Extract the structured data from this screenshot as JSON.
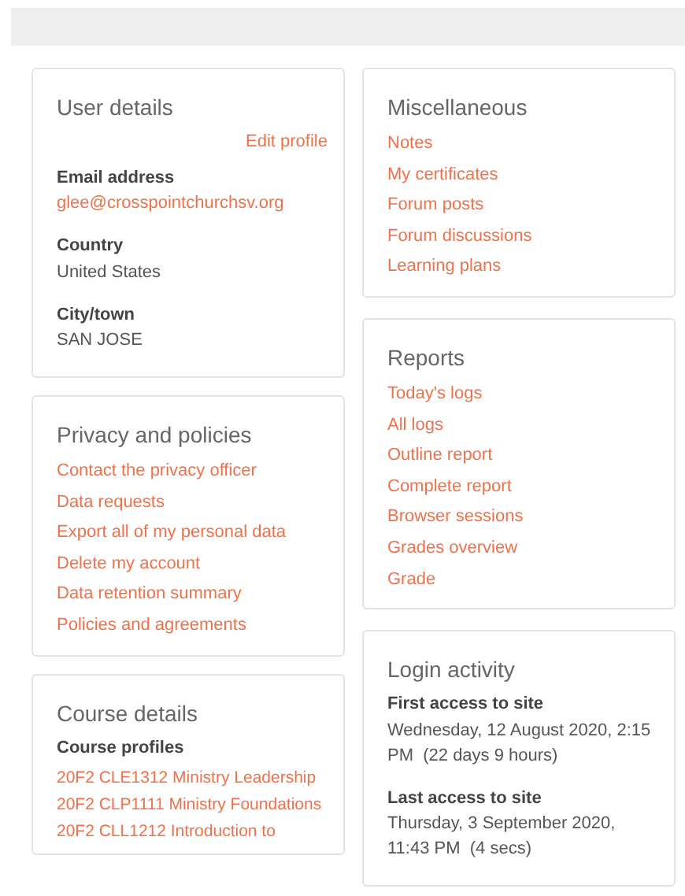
{
  "left_column": [
    {
      "kind": "details",
      "title": "User details",
      "action": "Edit profile",
      "fields": [
        {
          "label": "Email address",
          "value": "glee@crosspointchurchsv.org",
          "link": true
        },
        {
          "label": "Country",
          "value": "United States",
          "link": false
        },
        {
          "label": "City/town",
          "value": "SAN JOSE",
          "link": false
        }
      ]
    },
    {
      "kind": "links",
      "title": "Privacy and policies",
      "links": [
        "Contact the privacy officer",
        "Data requests",
        "Export all of my personal data",
        "Delete my account",
        "Data retention summary",
        "Policies and agreements"
      ]
    },
    {
      "kind": "courses",
      "title": "Course details",
      "subtitle": "Course profiles",
      "links": [
        "20F2 CLE1312 Ministry Leadership",
        "20F2 CLP1111 Ministry Foundations",
        "20F2 CLL1212 Introduction to"
      ]
    }
  ],
  "right_column": [
    {
      "kind": "links",
      "title": "Miscellaneous",
      "links": [
        "Notes",
        "My certificates",
        "Forum posts",
        "Forum discussions",
        "Learning plans"
      ]
    },
    {
      "kind": "links",
      "title": "Reports",
      "links": [
        "Today's logs",
        "All logs",
        "Outline report",
        "Complete report",
        "Browser sessions",
        "Grades overview",
        "Grade"
      ]
    },
    {
      "kind": "details",
      "title": "Login activity",
      "fields": [
        {
          "label": "First access to site",
          "value": "Wednesday, 12 August 2020, 2:15 PM  (22 days 9 hours)",
          "link": false
        },
        {
          "label": "Last access to site",
          "value": "Thursday, 3 September 2020, 11:43 PM  (4 secs)",
          "link": false
        }
      ]
    }
  ]
}
